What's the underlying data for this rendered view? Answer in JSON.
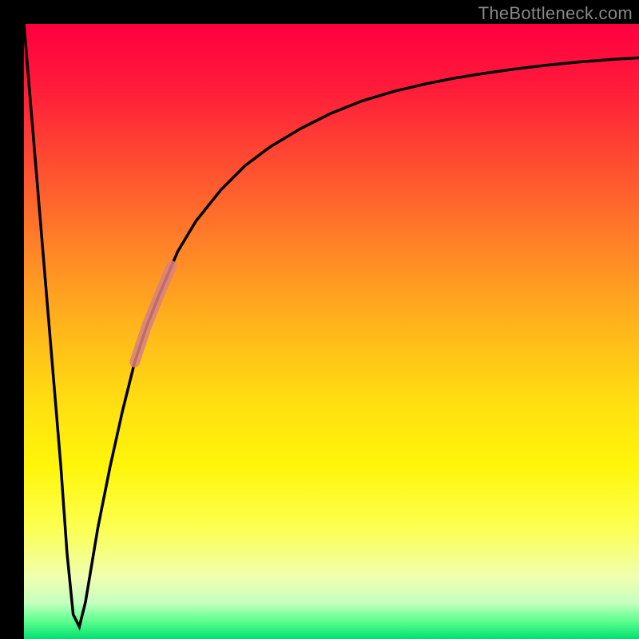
{
  "watermark": "TheBottleneck.com",
  "colors": {
    "frame": "#000000",
    "curve": "#000000",
    "highlight": "#d98080"
  },
  "chart_data": {
    "type": "line",
    "title": "",
    "xlabel": "",
    "ylabel": "",
    "xlim": [
      0,
      100
    ],
    "ylim": [
      0,
      100
    ],
    "grid": false,
    "series": [
      {
        "name": "bottleneck-curve",
        "x": [
          0,
          2,
          4,
          6,
          7,
          8,
          9,
          10,
          12,
          14,
          16,
          18,
          20,
          22,
          25,
          28,
          32,
          36,
          40,
          45,
          50,
          55,
          60,
          65,
          70,
          75,
          80,
          85,
          90,
          95,
          100
        ],
        "values": [
          100,
          76,
          52,
          28,
          14,
          4,
          2,
          6,
          18,
          28,
          37,
          45,
          51,
          56,
          63,
          68,
          73,
          77,
          80,
          83,
          85.5,
          87.5,
          89,
          90.2,
          91.2,
          92,
          92.7,
          93.3,
          93.8,
          94.2,
          94.5
        ]
      }
    ],
    "highlight_segment": {
      "series": "bottleneck-curve",
      "x_start": 18,
      "x_end": 24
    },
    "legend": null
  }
}
